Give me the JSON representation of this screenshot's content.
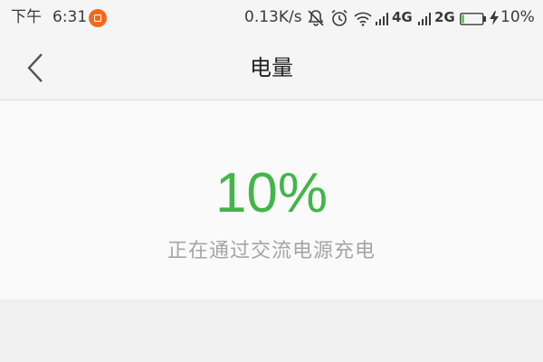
{
  "status_bar": {
    "period": "下午",
    "time": "6:31",
    "net_speed": "0.13K/s",
    "network_1": "4G",
    "network_2": "2G",
    "battery_percent": "10%",
    "battery_level": 0.1,
    "icons": [
      "notification-icon",
      "mute-icon",
      "alarm-icon",
      "wifi-icon",
      "signal-icon",
      "battery-icon",
      "charging-bolt-icon"
    ]
  },
  "header": {
    "title": "电量",
    "back_icon": "chevron-left-icon"
  },
  "battery": {
    "percent": "10%",
    "status": "正在通过交流电源充电"
  },
  "colors": {
    "accent_green": "#43b549",
    "status_gray": "#a5a5a5",
    "notify_orange": "#f26a1b"
  }
}
